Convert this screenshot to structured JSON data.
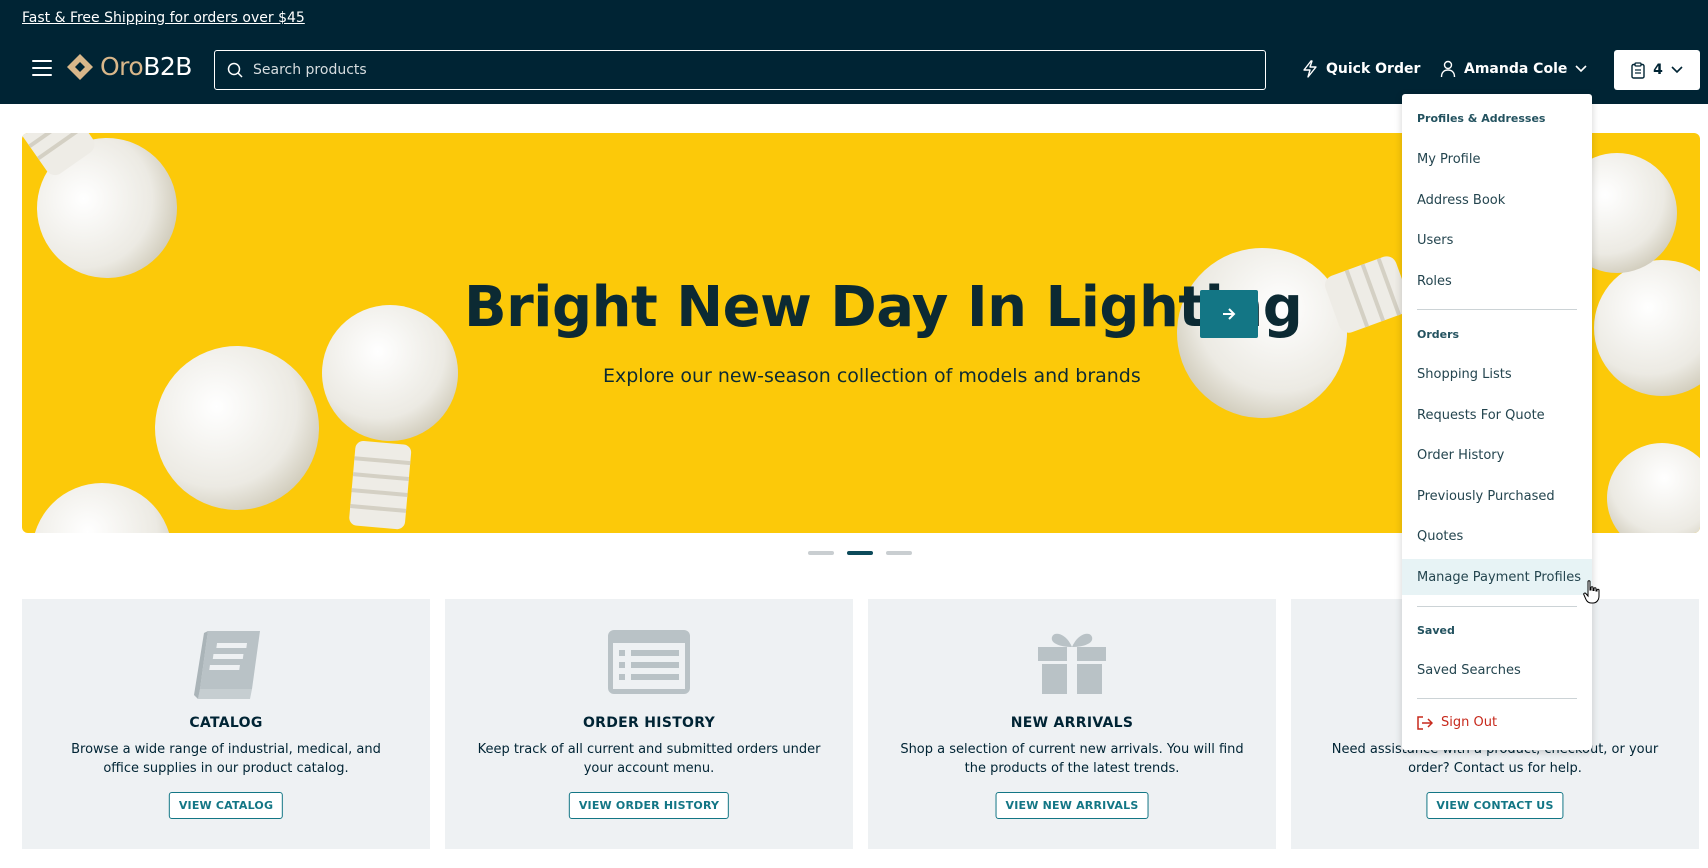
{
  "promo": {
    "text": "Fast & Free Shipping for orders over $45"
  },
  "header": {
    "logo_prefix": "Oro",
    "logo_suffix": "B2B",
    "search_placeholder": "Search products",
    "quick_order": "Quick Order",
    "user_name": "Amanda Cole",
    "cart_count": "4"
  },
  "hero": {
    "title": "Bright New Day In Lighting",
    "subtitle": "Explore our new-season collection of models and brands",
    "slides": 3,
    "active_slide": 2
  },
  "cards": [
    {
      "title": "CATALOG",
      "text": "Browse a wide range of industrial, medical, and office supplies in our product catalog.",
      "cta": "VIEW CATALOG",
      "icon": "book-icon"
    },
    {
      "title": "ORDER HISTORY",
      "text": "Keep track of all current and submitted orders under your account menu.",
      "cta": "VIEW ORDER HISTORY",
      "icon": "list-icon"
    },
    {
      "title": "NEW ARRIVALS",
      "text": "Shop a selection of current new arrivals. You will find the products of the latest trends.",
      "cta": "VIEW NEW ARRIVALS",
      "icon": "gift-icon"
    },
    {
      "title": "",
      "text": "Need assistance with a product, checkout, or your order? Contact us for help.",
      "cta": "VIEW CONTACT US",
      "icon": "support-icon"
    }
  ],
  "dropdown": {
    "section_profiles": "Profiles & Addresses",
    "profiles_items": [
      "My Profile",
      "Address Book",
      "Users",
      "Roles"
    ],
    "section_orders": "Orders",
    "orders_items": [
      "Shopping Lists",
      "Requests For Quote",
      "Order History",
      "Previously Purchased",
      "Quotes",
      "Manage Payment Profiles"
    ],
    "section_saved": "Saved",
    "saved_items": [
      "Saved Searches"
    ],
    "sign_out": "Sign Out"
  },
  "colors": {
    "header_bg": "#002434",
    "hero_bg": "#fcc909",
    "accent": "#137685",
    "card_bg": "#eef1f3",
    "sign_out": "#c7291c"
  }
}
